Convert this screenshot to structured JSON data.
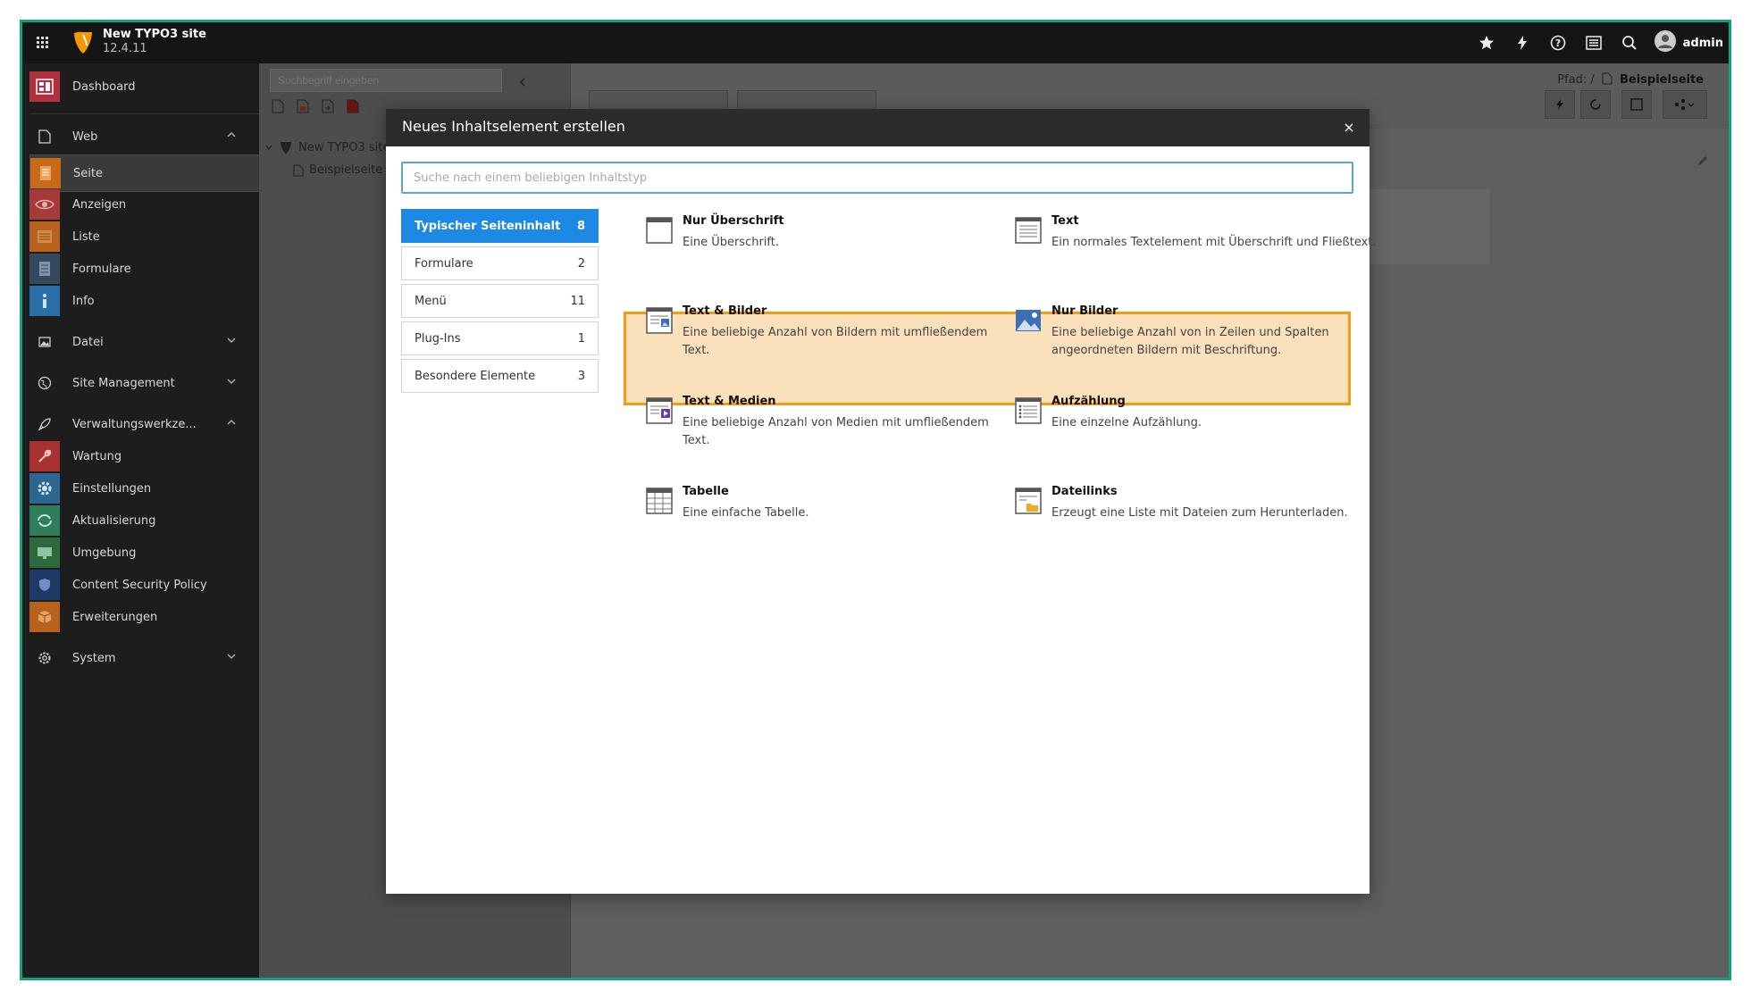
{
  "topbar": {
    "site_title": "New TYPO3 site",
    "site_version": "12.4.11",
    "user_name": "admin"
  },
  "sidebar": {
    "items": [
      {
        "label": "Dashboard",
        "icon": "dashboard-icon",
        "color": "#c0392b"
      },
      {
        "label": "Web",
        "icon": "web-page-icon"
      },
      {
        "label": "Seite",
        "icon": "page-module-icon",
        "color": "#e67e22"
      },
      {
        "label": "Anzeigen",
        "icon": "eye-icon",
        "color": "#c0392b"
      },
      {
        "label": "Liste",
        "icon": "list-icon",
        "color": "#e67e22"
      },
      {
        "label": "Formulare",
        "icon": "forms-icon",
        "color": "#2c3e50"
      },
      {
        "label": "Info",
        "icon": "info-icon",
        "color": "#2980b9"
      },
      {
        "label": "Datei",
        "icon": "file-image-icon"
      },
      {
        "label": "Site Management",
        "icon": "globe-icon"
      },
      {
        "label": "Verwaltungswerkze...",
        "icon": "rocket-icon"
      },
      {
        "label": "Wartung",
        "icon": "wrench-icon",
        "color": "#c0392b"
      },
      {
        "label": "Einstellungen",
        "icon": "settings-gear-icon",
        "color": "#2980b9"
      },
      {
        "label": "Aktualisierung",
        "icon": "refresh-icon",
        "color": "#27ae60"
      },
      {
        "label": "Umgebung",
        "icon": "monitor-icon",
        "color": "#27ae60"
      },
      {
        "label": "Content Security Policy",
        "icon": "shield-icon",
        "color": "#1f3b73"
      },
      {
        "label": "Erweiterungen",
        "icon": "box-icon",
        "color": "#e67e22"
      },
      {
        "label": "System",
        "icon": "system-gear-icon"
      }
    ]
  },
  "pagetree": {
    "search_placeholder": "Suchbegriff eingeben",
    "root_label": "New TYPO3 site",
    "child_label": "Beispielseite"
  },
  "main": {
    "path_label": "Pfad: /",
    "path_page": "Beispielseite"
  },
  "modal": {
    "title": "Neues Inhaltselement erstellen",
    "close_label": "×",
    "search_placeholder": "Suche nach einem beliebigen Inhaltstyp",
    "categories": [
      {
        "label": "Typischer Seiteninhalt",
        "count": "8"
      },
      {
        "label": "Formulare",
        "count": "2"
      },
      {
        "label": "Menü",
        "count": "11"
      },
      {
        "label": "Plug-Ins",
        "count": "1"
      },
      {
        "label": "Besondere Elemente",
        "count": "3"
      }
    ],
    "elements": [
      {
        "title": "Nur Überschrift",
        "desc": "Eine Überschrift.",
        "icon": "header-icon"
      },
      {
        "title": "Text",
        "desc": "Ein normales Textelement mit Überschrift und Fließtext.",
        "icon": "text-icon"
      },
      {
        "title": "Text & Bilder",
        "desc": "Eine beliebige Anzahl von Bildern mit umfließendem Text.",
        "icon": "text-images-icon"
      },
      {
        "title": "Nur Bilder",
        "desc": "Eine beliebige Anzahl von in Zeilen und Spalten angeordneten Bildern mit Beschriftung.",
        "icon": "images-icon"
      },
      {
        "title": "Text & Medien",
        "desc": "Eine beliebige Anzahl von Medien mit umfließendem Text.",
        "icon": "text-media-icon"
      },
      {
        "title": "Aufzählung",
        "desc": "Eine einzelne Aufzählung.",
        "icon": "bullets-icon"
      },
      {
        "title": "Tabelle",
        "desc": "Eine einfache Tabelle.",
        "icon": "table-icon"
      },
      {
        "title": "Dateilinks",
        "desc": "Erzeugt eine Liste mit Dateien zum Herunterladen.",
        "icon": "file-links-icon"
      }
    ]
  },
  "colors": {
    "accent_blue": "#1e88e5",
    "highlight_fill": "#fbe0bc",
    "highlight_border": "#f39c12",
    "frame_border": "#12a37a"
  }
}
